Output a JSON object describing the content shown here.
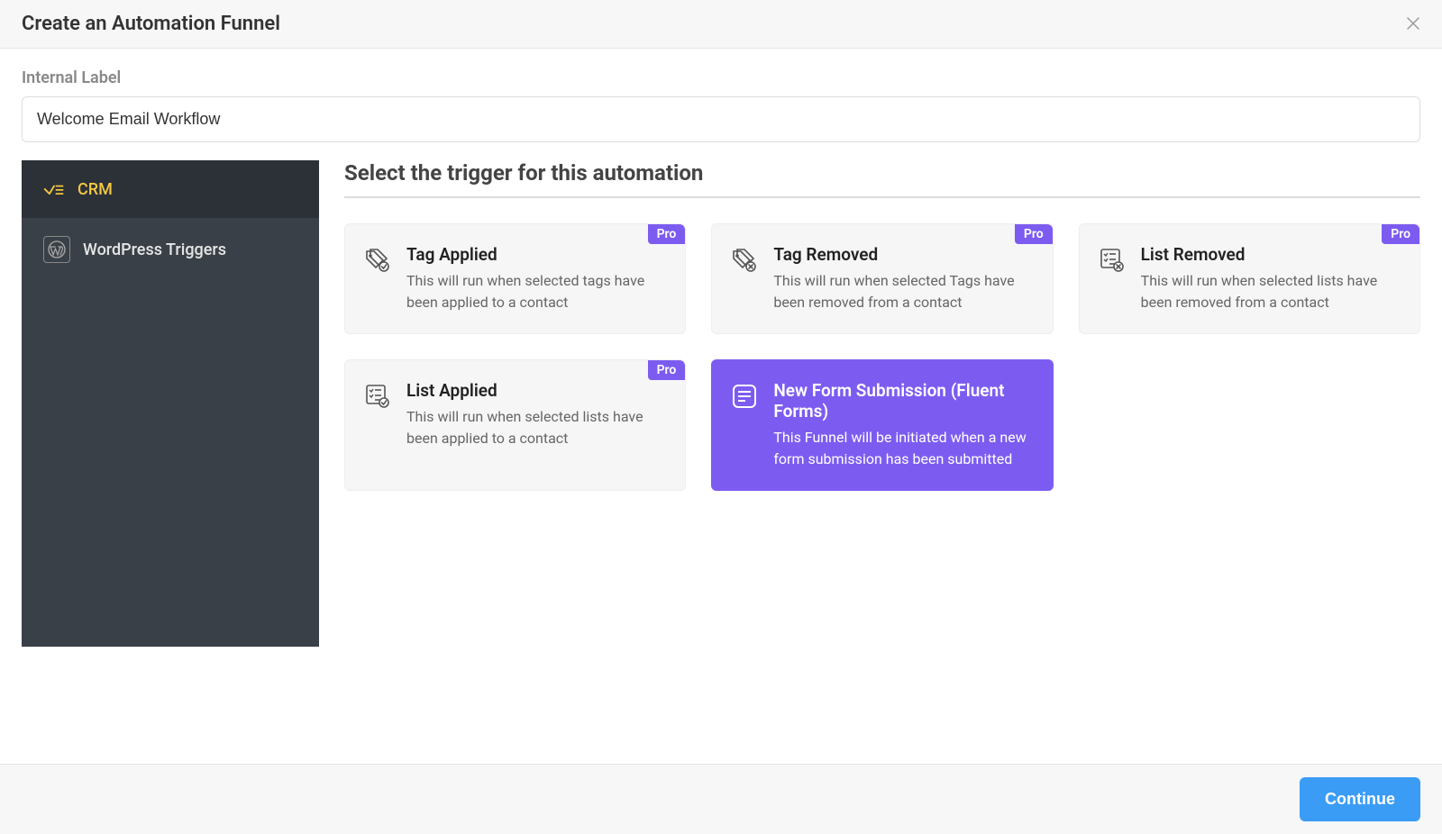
{
  "header": {
    "title": "Create an Automation Funnel"
  },
  "internalLabel": {
    "label": "Internal Label",
    "value": "Welcome Email Workflow"
  },
  "sidebar": {
    "items": [
      {
        "label": "CRM",
        "active": true
      },
      {
        "label": "WordPress Triggers",
        "active": false
      }
    ]
  },
  "triggerSection": {
    "title": "Select the trigger for this automation"
  },
  "triggers": [
    {
      "title": "Tag Applied",
      "desc": "This will run when selected tags have been applied to a contact",
      "pro": true,
      "selected": false,
      "icon": "tag-check"
    },
    {
      "title": "Tag Removed",
      "desc": "This will run when selected Tags have been removed from a contact",
      "pro": true,
      "selected": false,
      "icon": "tag-x"
    },
    {
      "title": "List Removed",
      "desc": "This will run when selected lists have been removed from a contact",
      "pro": true,
      "selected": false,
      "icon": "list-x"
    },
    {
      "title": "List Applied",
      "desc": "This will run when selected lists have been applied to a contact",
      "pro": true,
      "selected": false,
      "icon": "list-check"
    },
    {
      "title": "New Form Submission (Fluent Forms)",
      "desc": "This Funnel will be initiated when a new form submission has been submitted",
      "pro": false,
      "selected": true,
      "icon": "form"
    }
  ],
  "badges": {
    "pro": "Pro"
  },
  "footer": {
    "continue": "Continue"
  }
}
